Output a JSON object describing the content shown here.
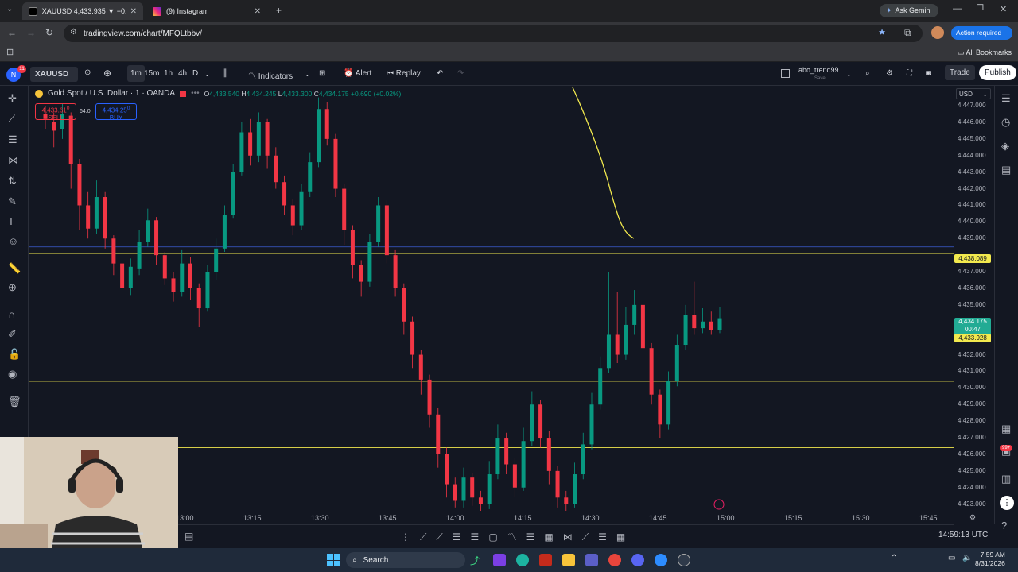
{
  "browser": {
    "tabs": [
      {
        "title": "XAUUSD 4,433.935 ▼ −0.47% ...",
        "active": true
      },
      {
        "title": "(9) Instagram",
        "active": false
      }
    ],
    "new_tab": "+",
    "ask_gemini": "Ask Gemini",
    "url": "tradingview.com/chart/MFQLtbbv/",
    "action_required": "Action required",
    "all_bookmarks": "All Bookmarks"
  },
  "tv_header": {
    "badge": "11",
    "symbol": "XAUUSD",
    "intervals": [
      "1m",
      "15m",
      "1h",
      "4h",
      "D"
    ],
    "indicators": "Indicators",
    "alert": "Alert",
    "replay": "Replay",
    "layout_name": "abo_trend99",
    "layout_sub": "Save",
    "trade": "Trade",
    "publish": "Publish",
    "currency": "USD"
  },
  "legend": {
    "title": "Gold Spot / U.S. Dollar · 1 · OANDA",
    "o_label": "O",
    "o": "4,433.540",
    "h_label": "H",
    "h": "4,434.245",
    "l_label": "L",
    "l": "4,433.300",
    "c_label": "C",
    "c": "4,434.175",
    "change": "+0.690 (+0.02%)",
    "sell_price": "4,433.61",
    "sell_sup": "0",
    "sell_label": "SELL",
    "spread": "64.0",
    "buy_price": "4,434.25",
    "buy_sup": "0",
    "buy_label": "BUY"
  },
  "chart_data": {
    "type": "candlestick",
    "symbol": "XAUUSD",
    "y_ticks": [
      "4,447.000",
      "4,446.000",
      "4,445.000",
      "4,444.000",
      "4,443.000",
      "4,442.000",
      "4,441.000",
      "4,440.000",
      "4,439.000",
      "4,437.000",
      "4,436.000",
      "4,435.000",
      "4,432.000",
      "4,431.000",
      "4,430.000",
      "4,429.000",
      "4,428.000",
      "4,427.000",
      "4,426.000",
      "4,425.000",
      "4,424.000",
      "4,423.000"
    ],
    "x_ticks": [
      "13:00",
      "13:15",
      "13:30",
      "13:45",
      "14:00",
      "14:15",
      "14:30",
      "14:45",
      "15:00",
      "15:15",
      "15:30",
      "15:45"
    ],
    "ylim": [
      4422.6,
      4448.2
    ],
    "price_labels": {
      "level": "4,438.089",
      "last": "4,434.175",
      "countdown": "00:47",
      "bid": "4,433.928"
    },
    "horizontal_lines": [
      4438.5,
      4438.1,
      4434.4,
      4430.4,
      4426.4
    ],
    "candles_open_close_high_low": [
      [
        4446.5,
        4446.2,
        4447.0,
        4445.6
      ],
      [
        4446.0,
        4445.5,
        4446.6,
        4444.5
      ],
      [
        4445.6,
        4446.5,
        4447.1,
        4445.0
      ],
      [
        4446.4,
        4443.5,
        4446.6,
        4442.0
      ],
      [
        4443.5,
        4441.0,
        4443.8,
        4439.5
      ],
      [
        4441.0,
        4439.6,
        4441.8,
        4439.0
      ],
      [
        4439.6,
        4441.5,
        4442.5,
        4439.3
      ],
      [
        4441.5,
        4439.0,
        4441.8,
        4438.4
      ],
      [
        4439.0,
        4437.5,
        4439.2,
        4436.8
      ],
      [
        4437.5,
        4436.0,
        4437.8,
        4435.4
      ],
      [
        4436.0,
        4437.3,
        4437.8,
        4435.6
      ],
      [
        4437.2,
        4438.8,
        4439.5,
        4436.8
      ],
      [
        4438.8,
        4440.1,
        4440.8,
        4438.5
      ],
      [
        4440.1,
        4438.0,
        4440.3,
        4437.4
      ],
      [
        4438.0,
        4436.6,
        4438.2,
        4436.2
      ],
      [
        4436.6,
        4435.8,
        4437.0,
        4435.2
      ],
      [
        4435.8,
        4437.5,
        4438.3,
        4435.5
      ],
      [
        4437.5,
        4436.0,
        4437.9,
        4435.3
      ],
      [
        4436.0,
        4434.8,
        4436.3,
        4433.7
      ],
      [
        4434.8,
        4437.0,
        4437.4,
        4434.6
      ],
      [
        4437.0,
        4438.4,
        4439.0,
        4436.5
      ],
      [
        4438.4,
        4440.4,
        4441.0,
        4438.2
      ],
      [
        4440.4,
        4443.0,
        4443.5,
        4440.2
      ],
      [
        4443.0,
        4445.4,
        4446.0,
        4442.8
      ],
      [
        4445.4,
        4444.0,
        4446.2,
        4443.4
      ],
      [
        4444.0,
        4446.0,
        4446.6,
        4443.6
      ],
      [
        4446.0,
        4444.0,
        4446.2,
        4443.2
      ],
      [
        4444.0,
        4442.4,
        4444.5,
        4442.0
      ],
      [
        4442.4,
        4441.0,
        4442.8,
        4440.4
      ],
      [
        4441.0,
        4439.8,
        4441.4,
        4439.2
      ],
      [
        4439.8,
        4441.8,
        4442.3,
        4439.5
      ],
      [
        4441.8,
        4443.6,
        4444.2,
        4441.5
      ],
      [
        4443.6,
        4446.8,
        4447.5,
        4443.3
      ],
      [
        4446.8,
        4445.0,
        4447.2,
        4444.6
      ],
      [
        4445.0,
        4442.0,
        4445.3,
        4441.5
      ],
      [
        4442.0,
        4439.5,
        4442.3,
        4438.6
      ],
      [
        4439.5,
        4437.4,
        4439.8,
        4436.6
      ],
      [
        4437.4,
        4436.4,
        4437.7,
        4435.5
      ],
      [
        4436.4,
        4438.8,
        4439.3,
        4436.1
      ],
      [
        4438.8,
        4441.0,
        4441.5,
        4438.5
      ],
      [
        4441.0,
        4438.0,
        4441.3,
        4437.5
      ],
      [
        4438.0,
        4436.0,
        4438.3,
        4435.5
      ],
      [
        4436.0,
        4434.0,
        4436.3,
        4433.2
      ],
      [
        4434.0,
        4432.0,
        4434.3,
        4431.2
      ],
      [
        4432.0,
        4430.5,
        4432.3,
        4429.6
      ],
      [
        4430.5,
        4428.4,
        4430.8,
        4427.6
      ],
      [
        4428.4,
        4426.0,
        4428.8,
        4425.2
      ],
      [
        4426.0,
        4424.2,
        4426.4,
        4423.4
      ],
      [
        4424.2,
        4423.2,
        4424.6,
        4422.8
      ],
      [
        4423.2,
        4424.6,
        4425.2,
        4422.8
      ],
      [
        4424.6,
        4423.4,
        4424.9,
        4422.9
      ],
      [
        4423.4,
        4423.0,
        4423.8,
        4422.6
      ],
      [
        4423.0,
        4424.8,
        4425.6,
        4422.7
      ],
      [
        4424.8,
        4427.0,
        4427.8,
        4424.5
      ],
      [
        4427.0,
        4425.4,
        4427.3,
        4424.8
      ],
      [
        4425.4,
        4424.0,
        4425.8,
        4423.4
      ],
      [
        4424.0,
        4426.8,
        4427.6,
        4423.8
      ],
      [
        4426.8,
        4429.0,
        4429.8,
        4426.5
      ],
      [
        4429.0,
        4427.0,
        4429.3,
        4426.4
      ],
      [
        4427.0,
        4425.0,
        4427.4,
        4424.2
      ],
      [
        4425.0,
        4423.4,
        4425.3,
        4422.8
      ],
      [
        4423.4,
        4423.0,
        4423.8,
        4422.6
      ],
      [
        4423.0,
        4424.8,
        4425.5,
        4422.8
      ],
      [
        4424.8,
        4426.6,
        4427.3,
        4424.5
      ],
      [
        4426.6,
        4429.0,
        4429.7,
        4426.3
      ],
      [
        4429.0,
        4431.2,
        4431.9,
        4428.7
      ],
      [
        4431.2,
        4433.2,
        4437.0,
        4430.9
      ],
      [
        4433.2,
        4432.0,
        4435.8,
        4431.5
      ],
      [
        4432.0,
        4433.8,
        4434.9,
        4431.7
      ],
      [
        4433.8,
        4435.0,
        4435.9,
        4433.2
      ],
      [
        4435.0,
        4432.4,
        4435.3,
        4431.8
      ],
      [
        4432.4,
        4429.6,
        4432.7,
        4429.0
      ],
      [
        4429.6,
        4427.8,
        4429.9,
        4427.0
      ],
      [
        4427.8,
        4430.4,
        4431.0,
        4427.5
      ],
      [
        4430.4,
        4432.6,
        4433.2,
        4430.1
      ],
      [
        4432.6,
        4434.4,
        4435.0,
        4432.3
      ],
      [
        4434.4,
        4433.6,
        4436.4,
        4433.2
      ],
      [
        4433.6,
        4434.0,
        4434.8,
        4433.3
      ],
      [
        4434.0,
        4433.5,
        4434.6,
        4433.2
      ],
      [
        4433.5,
        4434.2,
        4434.9,
        4433.3
      ]
    ]
  },
  "bottom": {
    "utc": "14:59:13 UTC"
  },
  "taskbar": {
    "search": "Search",
    "time": "7:59 AM",
    "date": "8/31/2026",
    "notif": "99+"
  }
}
